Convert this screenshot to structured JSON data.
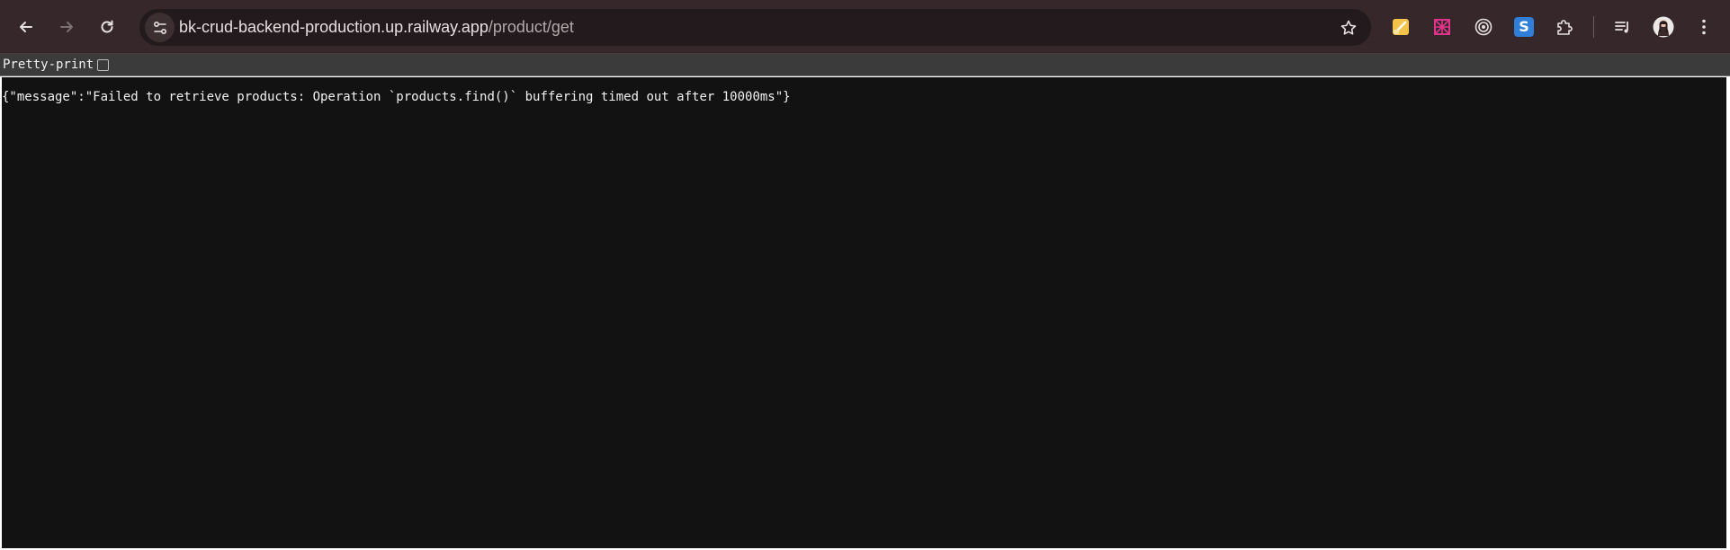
{
  "browser": {
    "url_host": "bk-crud-backend-production.up.railway.app",
    "url_path": "/product/get",
    "nav": [
      "back-icon",
      "forward-icon",
      "reload-icon"
    ],
    "extensions": [
      "note-extension-icon",
      "crossed-grid-extension-icon",
      "target-extension-icon",
      "s-extension-icon",
      "puzzle-extensions-icon",
      "media-playlist-icon",
      "profile-avatar",
      "kebab-menu-icon"
    ],
    "extension_s_letter": "S",
    "colors": {
      "toolbar": "#35272a",
      "omnibox": "#221a1c",
      "content": "#121212"
    }
  },
  "viewer": {
    "pretty_print_label": "Pretty-print",
    "pretty_print_checked": false
  },
  "response": {
    "body": "{\"message\":\"Failed to retrieve products: Operation `products.find()` buffering timed out after 10000ms\"}"
  }
}
